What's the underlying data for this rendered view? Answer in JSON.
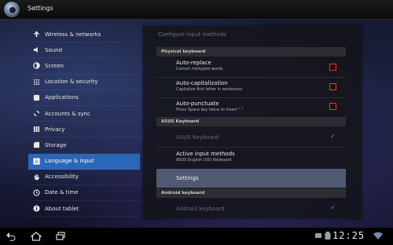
{
  "app": {
    "title": "Settings",
    "icon": "settings-gear-icon"
  },
  "sidebar": {
    "items": [
      {
        "label": "Wireless & networks",
        "icon": "wireless-icon",
        "selected": false
      },
      {
        "label": "Sound",
        "icon": "speaker-icon",
        "selected": false
      },
      {
        "label": "Screen",
        "icon": "brightness-icon",
        "selected": false
      },
      {
        "label": "Location & security",
        "icon": "grid-lock-icon",
        "selected": false
      },
      {
        "label": "Applications",
        "icon": "apps-icon",
        "selected": false
      },
      {
        "label": "Accounts & sync",
        "icon": "sync-icon",
        "selected": false
      },
      {
        "label": "Privacy",
        "icon": "privacy-icon",
        "selected": false
      },
      {
        "label": "Storage",
        "icon": "storage-icon",
        "selected": false
      },
      {
        "label": "Language & input",
        "icon": "keyboard-a-icon",
        "selected": true
      },
      {
        "label": "Accessibility",
        "icon": "hand-icon",
        "selected": false
      },
      {
        "label": "Date & time",
        "icon": "clock-icon",
        "selected": false
      },
      {
        "label": "About tablet",
        "icon": "info-icon",
        "selected": false
      }
    ],
    "selected_color": "#2b66b7"
  },
  "panel": {
    "title": "Configure input methods",
    "physical_section": "Physical keyboard",
    "auto_replace": {
      "title": "Auto-replace",
      "sub": "Correct mistyped words"
    },
    "auto_cap": {
      "title": "Auto-capitalization",
      "sub": "Capitalize first letter in sentences"
    },
    "auto_punct": {
      "title": "Auto-punctuate",
      "sub": "Press Space key twice to insert \".\""
    },
    "asus_section": "ASUS Keyboard",
    "asus_keyboard": {
      "title": "ASUS Keyboard",
      "enabled": false
    },
    "active_methods": {
      "title": "Active input methods",
      "sub": "ASUS English (US) Keyboard"
    },
    "settings": {
      "title": "Settings"
    },
    "android_section": "Android keyboard",
    "android_keyboard": {
      "title": "Android keyboard",
      "enabled": false
    },
    "checkbox_color": "#e33"
  },
  "status": {
    "time": "12:25"
  },
  "navbar": {
    "back": "back-icon",
    "home": "home-icon",
    "recent": "recent-apps-icon"
  }
}
